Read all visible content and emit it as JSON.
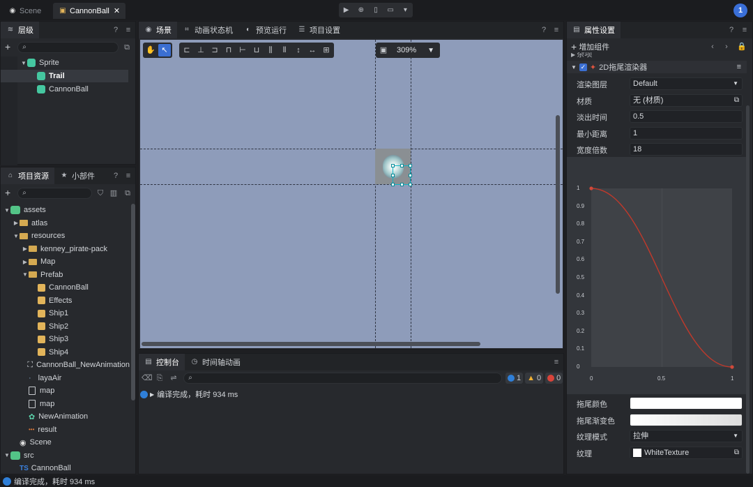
{
  "topbar": {
    "tabs": [
      {
        "label": "Scene",
        "active": false
      },
      {
        "label": "CannonBall",
        "active": true
      }
    ],
    "badge": "1"
  },
  "hierarchy": {
    "title": "层级",
    "items": [
      {
        "label": "Sprite",
        "depth": 1,
        "icon": "sprite-icon",
        "expanded": true
      },
      {
        "label": "Trail",
        "depth": 2,
        "icon": "sprite-icon",
        "selected": true
      },
      {
        "label": "CannonBall",
        "depth": 2,
        "icon": "sprite-icon"
      }
    ]
  },
  "assets": {
    "tabs": [
      {
        "label": "项目资源",
        "active": true
      },
      {
        "label": "小部件",
        "active": false
      }
    ],
    "items": [
      {
        "label": "assets",
        "depth": 0,
        "icon": "package-icon",
        "arrow": "▼"
      },
      {
        "label": "atlas",
        "depth": 1,
        "icon": "folder-icon",
        "arrow": "▶"
      },
      {
        "label": "resources",
        "depth": 1,
        "icon": "folder-icon",
        "arrow": "▼"
      },
      {
        "label": "kenney_pirate-pack",
        "depth": 2,
        "icon": "folder-icon",
        "arrow": "▶"
      },
      {
        "label": "Map",
        "depth": 2,
        "icon": "folder-icon",
        "arrow": "▶"
      },
      {
        "label": "Prefab",
        "depth": 2,
        "icon": "folder-icon",
        "arrow": "▼"
      },
      {
        "label": "CannonBall",
        "depth": 3,
        "icon": "prefab-icon"
      },
      {
        "label": "Effects",
        "depth": 3,
        "icon": "prefab-icon"
      },
      {
        "label": "Ship1",
        "depth": 3,
        "icon": "prefab-icon"
      },
      {
        "label": "Ship2",
        "depth": 3,
        "icon": "prefab-icon"
      },
      {
        "label": "Ship3",
        "depth": 3,
        "icon": "prefab-icon"
      },
      {
        "label": "Ship4",
        "depth": 3,
        "icon": "prefab-icon"
      },
      {
        "label": "CannonBall_NewAnimation",
        "depth": 2,
        "icon": "animation-icon"
      },
      {
        "label": "layaAir",
        "depth": 2,
        "icon": "dot-icon"
      },
      {
        "label": "map",
        "depth": 2,
        "icon": "document-icon"
      },
      {
        "label": "map",
        "depth": 2,
        "icon": "document-icon"
      },
      {
        "label": "NewAnimation",
        "depth": 2,
        "icon": "animation-clip-icon"
      },
      {
        "label": "result",
        "depth": 2,
        "icon": "dots-icon"
      },
      {
        "label": "Scene",
        "depth": 1,
        "icon": "scene-icon"
      },
      {
        "label": "src",
        "depth": 0,
        "icon": "package-icon",
        "arrow": "▼"
      },
      {
        "label": "CannonBall",
        "depth": 1,
        "icon": "ts-icon",
        "prefix": "TS"
      }
    ]
  },
  "center": {
    "tabs": [
      {
        "label": "场景",
        "active": true
      },
      {
        "label": "动画状态机"
      },
      {
        "label": "预览运行"
      },
      {
        "label": "项目设置"
      }
    ],
    "zoom": "309%"
  },
  "console": {
    "tabs": [
      {
        "label": "控制台",
        "active": true
      },
      {
        "label": "时间轴动画"
      }
    ],
    "counts": {
      "info": "1",
      "warn": "0",
      "error": "0"
    },
    "message": "编译完成，耗时 934 ms"
  },
  "statusbar": {
    "message": "编译完成，耗时 934 ms"
  },
  "inspector": {
    "title": "属性设置",
    "add_component": "增加组件",
    "collapsed_section": "杂项",
    "component": "2D拖尾渲染器",
    "props": [
      {
        "label": "渲染图层",
        "value": "Default",
        "type": "select"
      },
      {
        "label": "材质",
        "value": "无 (材质)",
        "type": "ref"
      },
      {
        "label": "淡出时间",
        "value": "0.5"
      },
      {
        "label": "最小距离",
        "value": "1"
      },
      {
        "label": "宽度倍数",
        "value": "18"
      }
    ],
    "curve": {
      "yticks": [
        "1",
        "0.9",
        "0.8",
        "0.7",
        "0.6",
        "0.5",
        "0.4",
        "0.3",
        "0.2",
        "0.1",
        "0"
      ],
      "xticks": [
        "0",
        "0.5",
        "1"
      ],
      "points": [
        [
          0,
          1
        ],
        [
          1,
          0
        ]
      ],
      "color": "#c0392b"
    },
    "props2": [
      {
        "label": "拖尾颜色",
        "value": "",
        "type": "color"
      },
      {
        "label": "拖尾渐变色",
        "value": "",
        "type": "gradient"
      },
      {
        "label": "纹理模式",
        "value": "拉伸",
        "type": "select"
      },
      {
        "label": "纹理",
        "value": "WhiteTexture",
        "type": "ref"
      }
    ]
  }
}
